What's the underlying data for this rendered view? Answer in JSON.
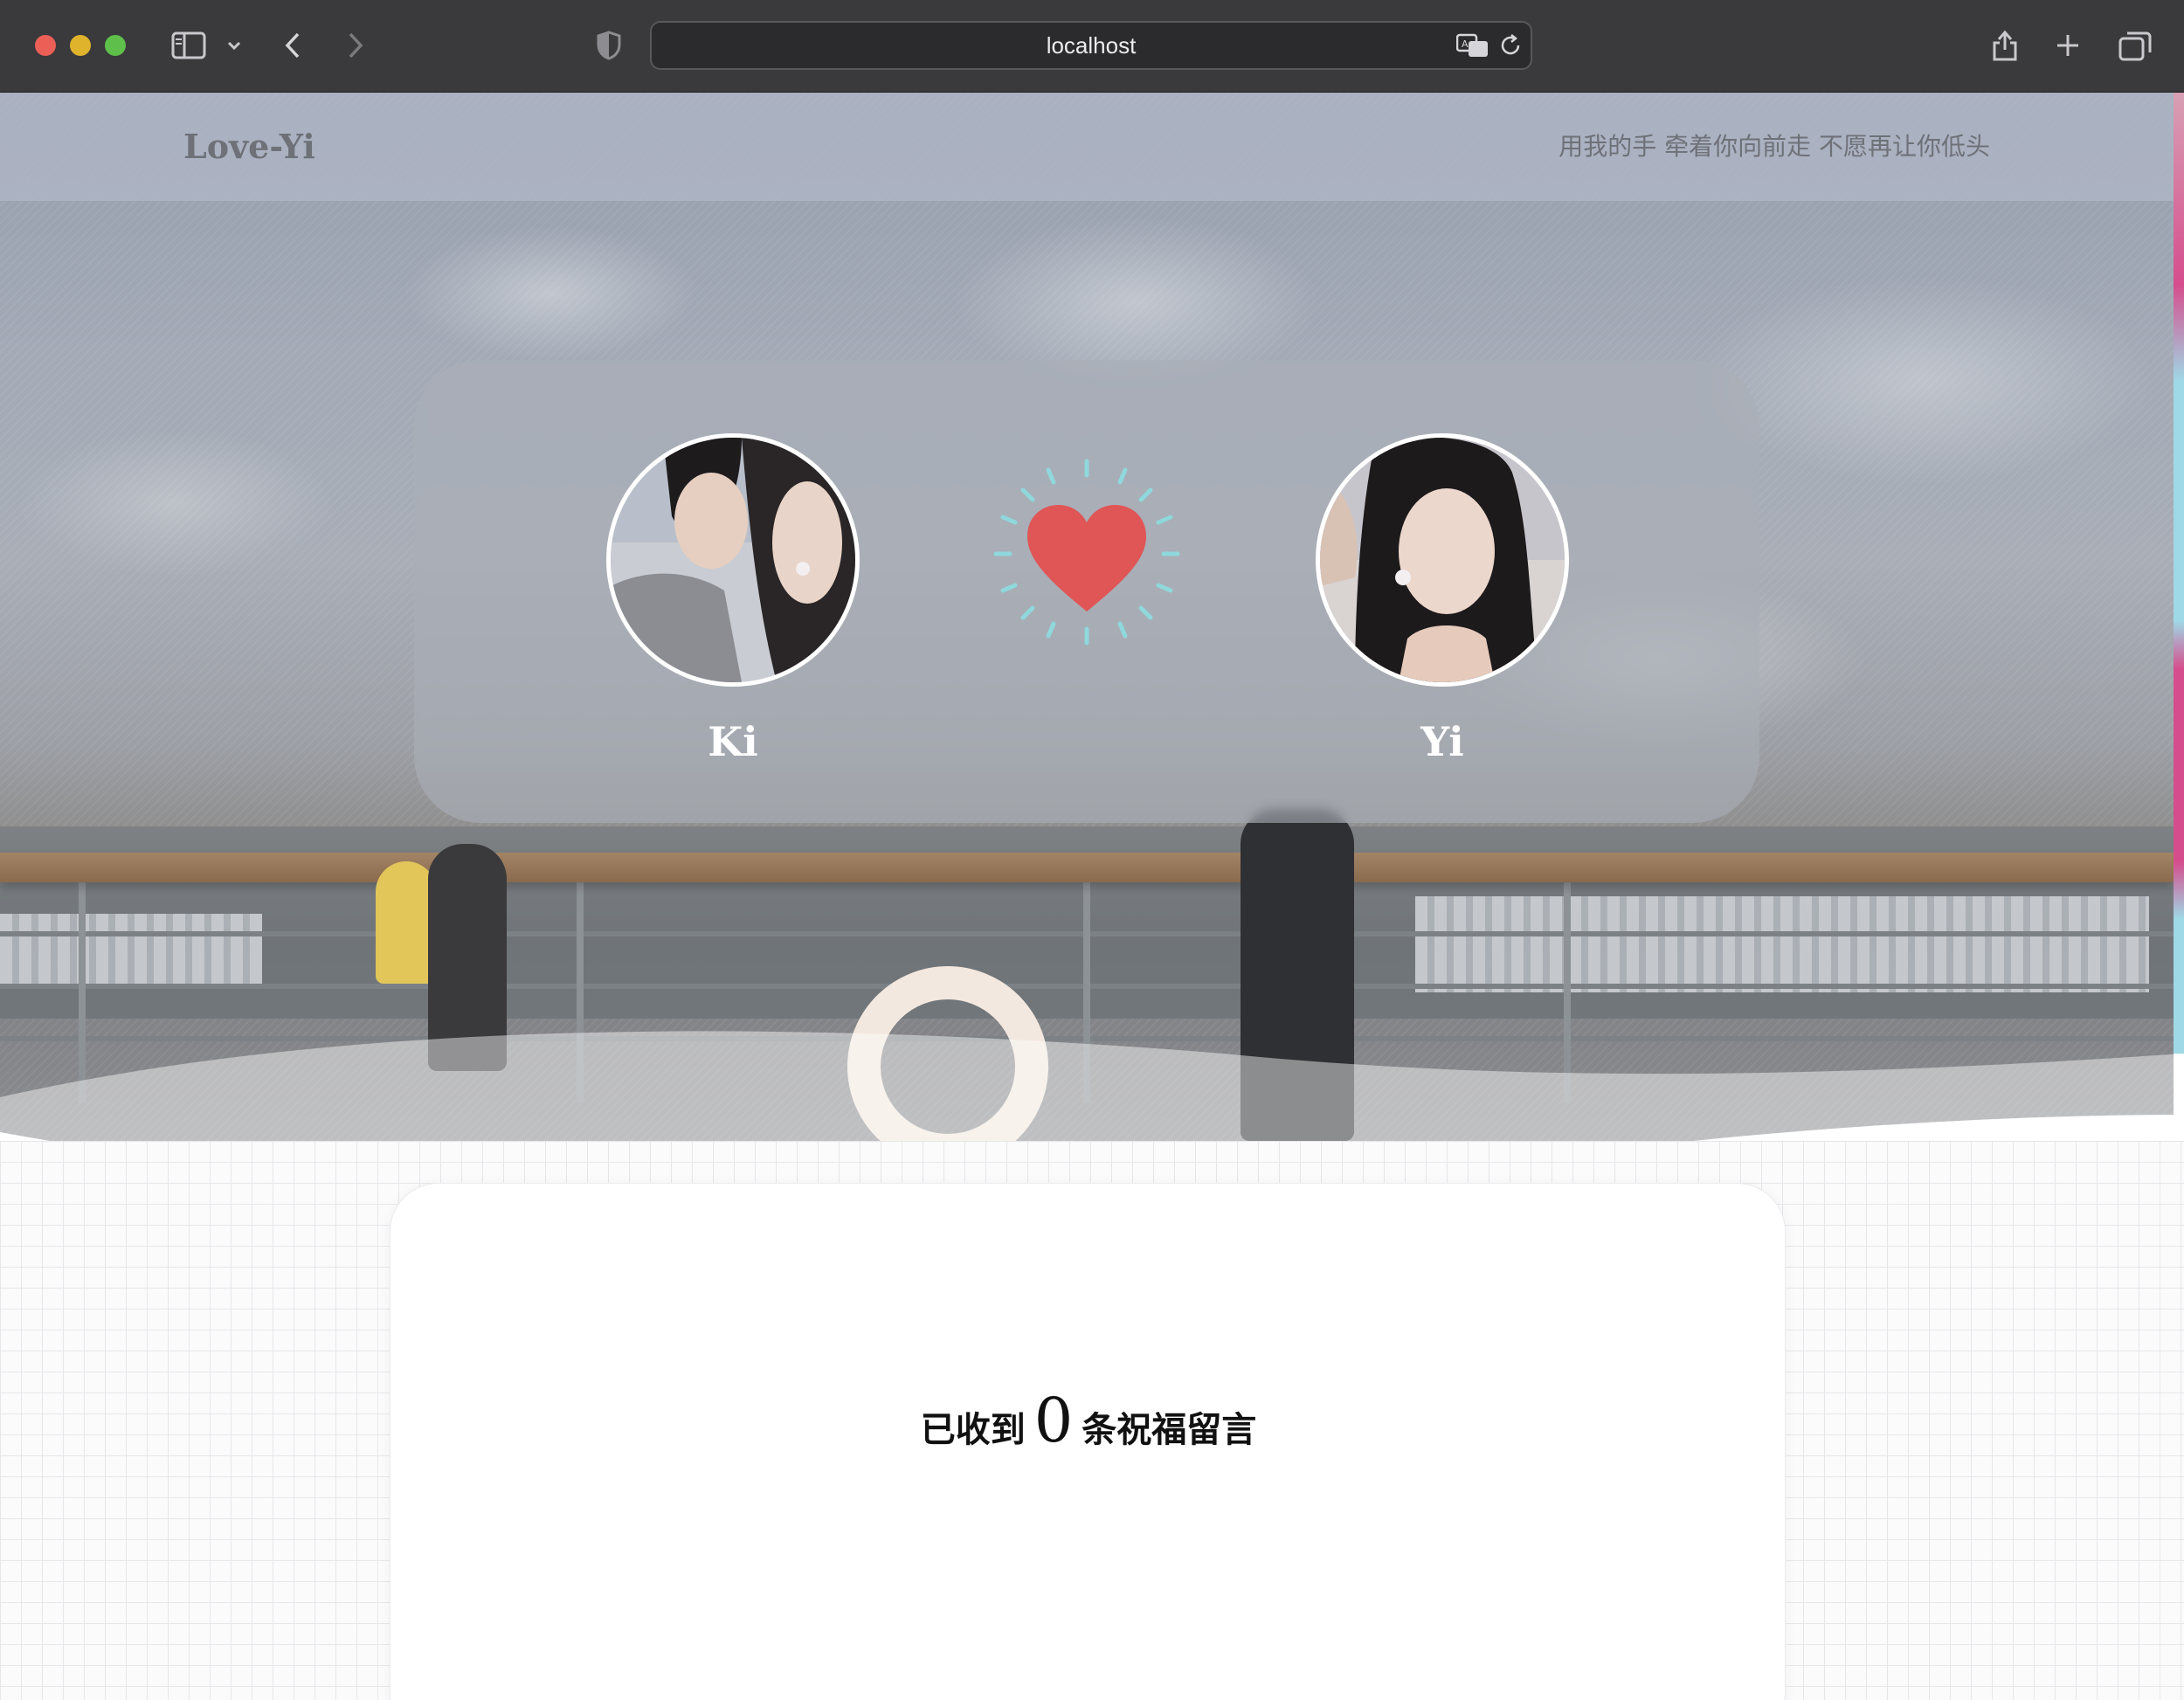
{
  "browser": {
    "url": "localhost",
    "icons": [
      "sidebar-icon",
      "chevron-down-icon",
      "back-arrow-icon",
      "forward-arrow-icon",
      "shield-icon",
      "translate-icon",
      "reload-icon",
      "share-icon",
      "plus-icon",
      "tabs-icon"
    ]
  },
  "header": {
    "brand": "Love-Yi",
    "tagline": "用我的手 牵着你向前走 不愿再让你低头"
  },
  "couple": {
    "left_name": "Ki",
    "right_name": "Yi",
    "heart_color": "#e05555",
    "sparkle_color": "#8fd8dc"
  },
  "messages": {
    "prefix": "已收到",
    "count": "0",
    "suffix": "条祝福留言"
  },
  "colors": {
    "accent_pink": "#d64d8d",
    "accent_cyan": "#9fd8e6",
    "dotted_divider": "#efb9bf"
  }
}
